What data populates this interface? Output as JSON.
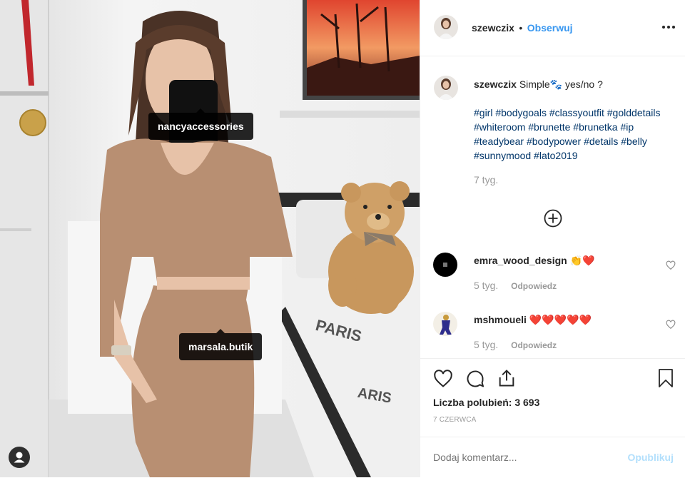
{
  "post": {
    "author": "szewczix",
    "follow_label": "Obserwuj",
    "separator": "•",
    "more_icon": "more-horizontal-icon",
    "photo_tags": [
      "nancyaccessories",
      "marsala.butik"
    ],
    "caption": {
      "username": "szewczix",
      "text": "Simple🐾 yes/no ?",
      "hashtags": "#girl #bodygoals #classyoutfit #golddetails #whiteroom #brunette #brunetka #ip #teadybear #bodypower #details #belly #sunnymood #lato2019",
      "time": "7 tyg."
    },
    "load_more_icon": "plus-circle-icon",
    "comments": [
      {
        "username": "emra_wood_design",
        "text": "👏❤️",
        "time": "5 tyg.",
        "reply": "Odpowiedz"
      },
      {
        "username": "mshmoueli",
        "text": "❤️❤️❤️❤️❤️",
        "time": "5 tyg.",
        "reply": "Odpowiedz"
      }
    ],
    "likes": "Liczba polubień: 3 693",
    "date": "7 CZERWCA",
    "comment_placeholder": "Dodaj komentarz...",
    "publish_label": "Opublikuj"
  },
  "colors": {
    "link": "#3897f0",
    "hashtag": "#003569",
    "muted": "#999999",
    "publish_disabled": "#b2dffc",
    "heart": "#ed4956"
  }
}
